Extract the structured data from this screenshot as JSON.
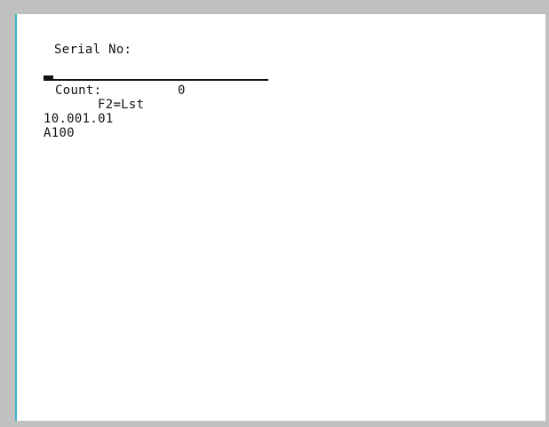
{
  "screen": {
    "serial_label": "Serial No:",
    "serial_value": "",
    "count_label": "Count:",
    "count_value": "0",
    "f2_hint": "F2=Lst",
    "version": "10.001.01",
    "code": "A100"
  },
  "colors": {
    "background": "#c0c0c0",
    "screen": "#ffffff",
    "accent_border": "#38b6c8",
    "text": "#111111"
  }
}
